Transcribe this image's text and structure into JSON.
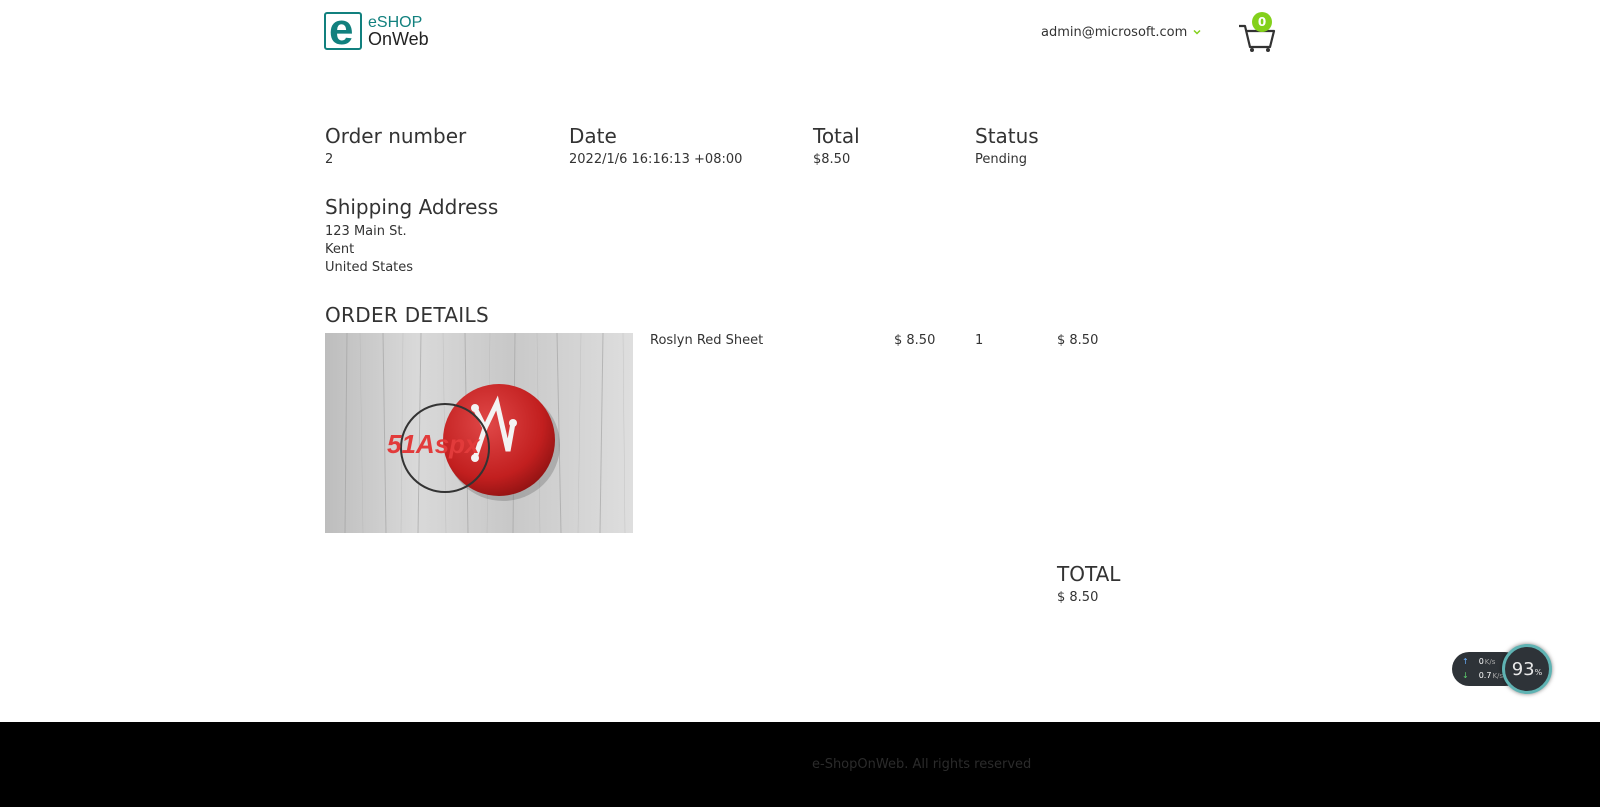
{
  "header": {
    "logo_line1": "eSHOP",
    "logo_line2": "OnWeb",
    "user_email": "admin@microsoft.com",
    "cart_count": "0"
  },
  "order": {
    "number_label": "Order number",
    "number_value": "2",
    "date_label": "Date",
    "date_value": "2022/1/6 16:16:13 +08:00",
    "total_label": "Total",
    "total_value": "$8.50",
    "status_label": "Status",
    "status_value": "Pending"
  },
  "shipping": {
    "title": "Shipping Address",
    "street": "123 Main St.",
    "city": "Kent",
    "country": "United States"
  },
  "details": {
    "title": "ORDER DETAILS",
    "items": [
      {
        "name": "Roslyn Red Sheet",
        "price": "$ 8.50",
        "quantity": "1",
        "subtotal": "$ 8.50",
        "image_watermark": "51Aspx"
      }
    ],
    "total_label": "TOTAL",
    "total_value": "$ 8.50"
  },
  "network_widget": {
    "upload": "0",
    "upload_unit": "K/s",
    "download": "0.7",
    "download_unit": "K/s",
    "percent": "93",
    "percent_unit": "%"
  },
  "footer": {
    "text": "e-ShopOnWeb. All rights reserved"
  },
  "colors": {
    "brand": "#11807e",
    "badge": "#83d01b",
    "footer_bg": "#000000"
  }
}
